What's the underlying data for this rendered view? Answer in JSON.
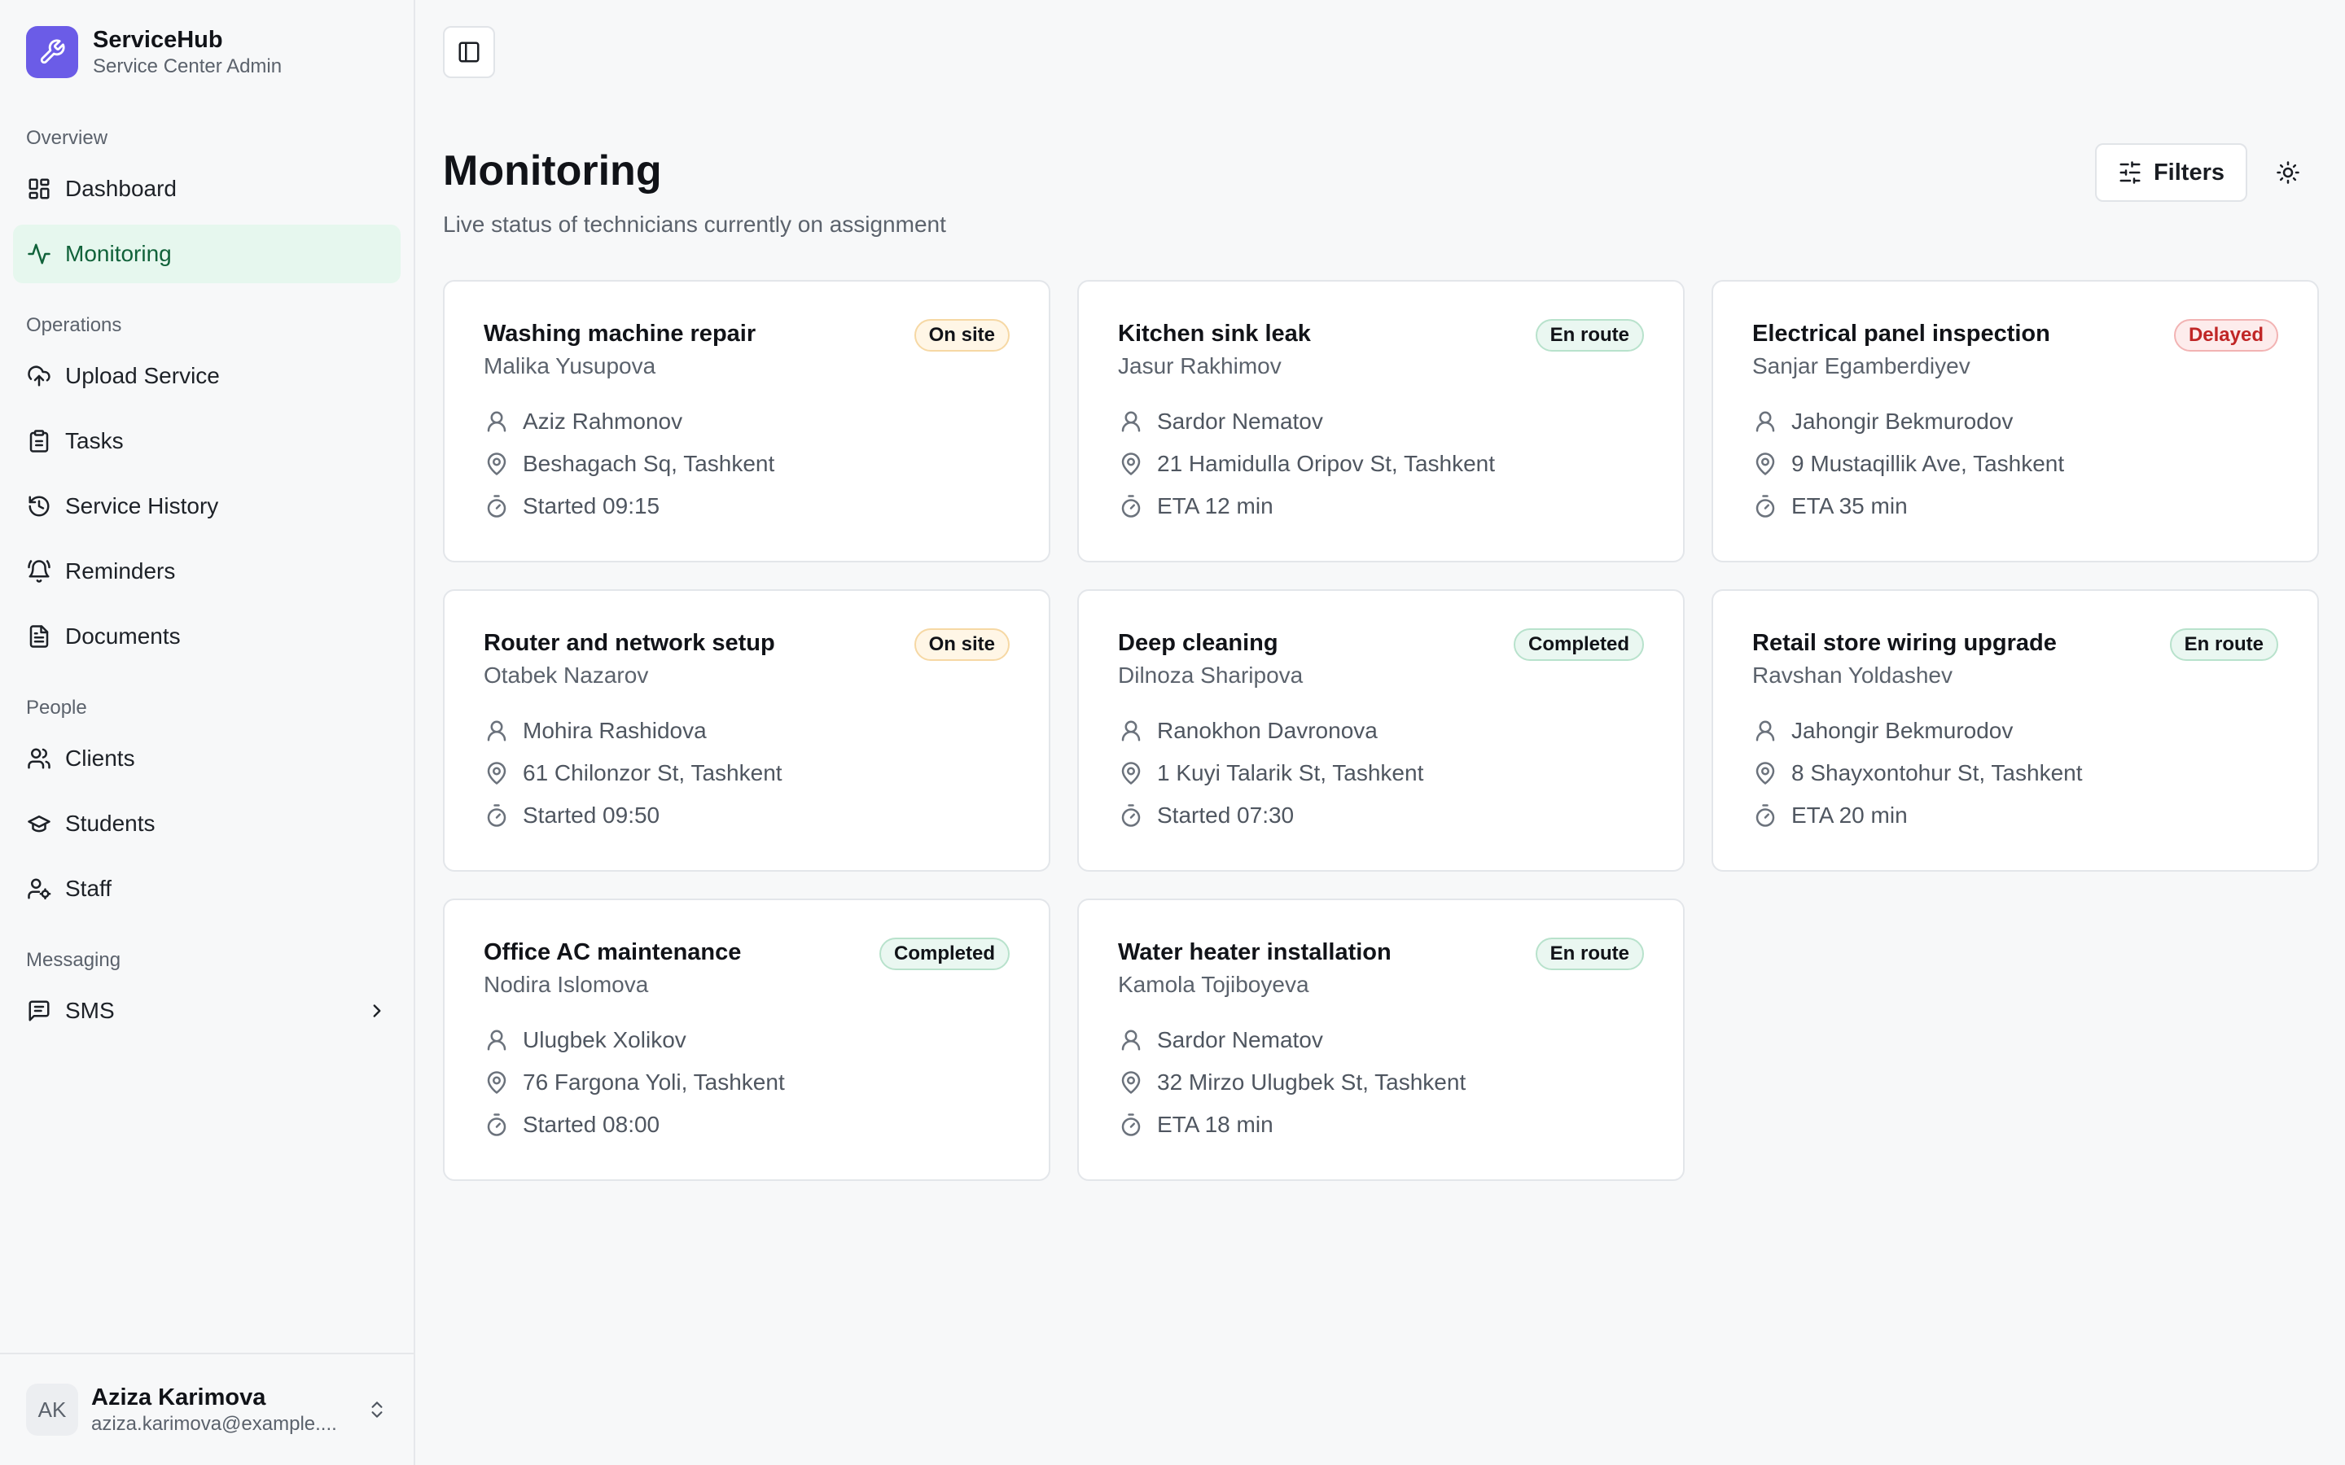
{
  "brand": {
    "name": "ServiceHub",
    "subtitle": "Service Center Admin"
  },
  "sidebar": {
    "sections": [
      {
        "label": "Overview",
        "items": [
          {
            "label": "Dashboard",
            "icon": "dashboard-icon"
          },
          {
            "label": "Monitoring",
            "icon": "activity-icon",
            "active": true
          }
        ]
      },
      {
        "label": "Operations",
        "items": [
          {
            "label": "Upload Service",
            "icon": "upload-cloud-icon"
          },
          {
            "label": "Tasks",
            "icon": "clipboard-icon"
          },
          {
            "label": "Service History",
            "icon": "history-icon"
          },
          {
            "label": "Reminders",
            "icon": "bell-icon"
          },
          {
            "label": "Documents",
            "icon": "document-icon"
          }
        ]
      },
      {
        "label": "People",
        "items": [
          {
            "label": "Clients",
            "icon": "users-icon"
          },
          {
            "label": "Students",
            "icon": "graduation-cap-icon"
          },
          {
            "label": "Staff",
            "icon": "user-cog-icon"
          }
        ]
      },
      {
        "label": "Messaging",
        "items": [
          {
            "label": "SMS",
            "icon": "message-icon",
            "has_chevron": true
          }
        ]
      }
    ]
  },
  "user": {
    "initials": "AK",
    "name": "Aziza Karimova",
    "email": "aziza.karimova@example...."
  },
  "header": {
    "title": "Monitoring",
    "subtitle": "Live status of technicians currently on assignment",
    "filters_label": "Filters"
  },
  "colors": {
    "accent": "#6b5ce7",
    "active_bg": "#e6f7ee",
    "active_text": "#11623a",
    "delayed": "#c02626"
  },
  "cards": [
    {
      "title": "Washing machine repair",
      "client": "Malika Yusupova",
      "status": "On site",
      "status_kind": "onsite",
      "technician": "Aziz Rahmonov",
      "address": "Beshagach Sq, Tashkent",
      "time": "Started 09:15"
    },
    {
      "title": "Kitchen sink leak",
      "client": "Jasur Rakhimov",
      "status": "En route",
      "status_kind": "enroute",
      "technician": "Sardor Nematov",
      "address": "21 Hamidulla Oripov St, Tashkent",
      "time": "ETA 12 min"
    },
    {
      "title": "Electrical panel inspection",
      "client": "Sanjar Egamberdiyev",
      "status": "Delayed",
      "status_kind": "delayed",
      "technician": "Jahongir Bekmurodov",
      "address": "9 Mustaqillik Ave, Tashkent",
      "time": "ETA 35 min"
    },
    {
      "title": "Router and network setup",
      "client": "Otabek Nazarov",
      "status": "On site",
      "status_kind": "onsite",
      "technician": "Mohira Rashidova",
      "address": "61 Chilonzor St, Tashkent",
      "time": "Started 09:50"
    },
    {
      "title": "Deep cleaning",
      "client": "Dilnoza Sharipova",
      "status": "Completed",
      "status_kind": "completed",
      "technician": "Ranokhon Davronova",
      "address": "1 Kuyi Talarik St, Tashkent",
      "time": "Started 07:30"
    },
    {
      "title": "Retail store wiring upgrade",
      "client": "Ravshan Yoldashev",
      "status": "En route",
      "status_kind": "enroute",
      "technician": "Jahongir Bekmurodov",
      "address": "8 Shayxontohur St, Tashkent",
      "time": "ETA 20 min"
    },
    {
      "title": "Office AC maintenance",
      "client": "Nodira Islomova",
      "status": "Completed",
      "status_kind": "completed",
      "technician": "Ulugbek Xolikov",
      "address": "76 Fargona Yoli, Tashkent",
      "time": "Started 08:00"
    },
    {
      "title": "Water heater installation",
      "client": "Kamola Tojiboyeva",
      "status": "En route",
      "status_kind": "enroute",
      "technician": "Sardor Nematov",
      "address": "32 Mirzo Ulugbek St, Tashkent",
      "time": "ETA 18 min"
    }
  ]
}
